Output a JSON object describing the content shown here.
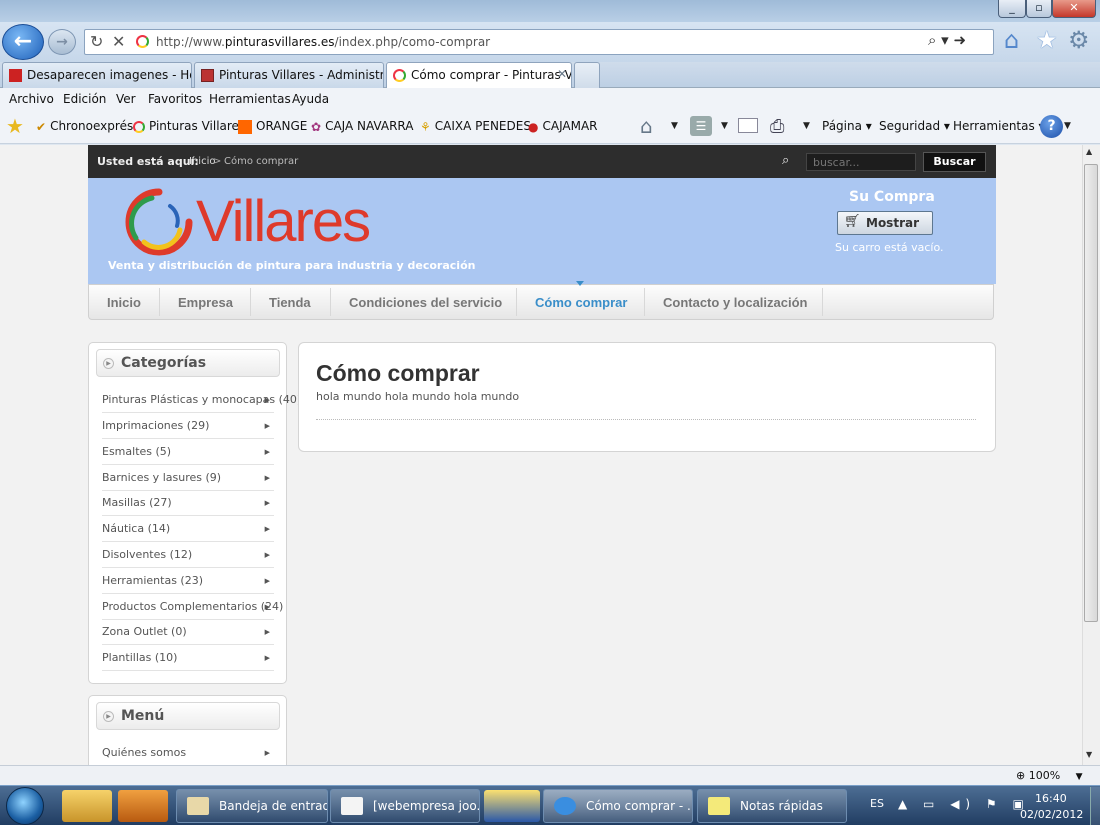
{
  "browser": {
    "url_prefix": "http://www.",
    "url_domain": "pinturasvillares.es",
    "url_path": "/index.php/como-comprar",
    "tabs": [
      {
        "label": "Desaparecen imagenes - Hosti..."
      },
      {
        "label": "Pinturas Villares - Administraci..."
      },
      {
        "label": "Cómo comprar - Pinturas V..."
      }
    ],
    "menu": [
      "Archivo",
      "Edición",
      "Ver",
      "Favoritos",
      "Herramientas",
      "Ayuda"
    ],
    "favorites": [
      "Chronoexprés",
      "Pinturas Villares",
      "ORANGE",
      "CAJA NAVARRA",
      "CAIXA PENEDES",
      "CAJAMAR"
    ],
    "commands": {
      "page": "Página ▾",
      "security": "Seguridad ▾",
      "tools": "Herramientas ▾"
    },
    "zoom": "100%"
  },
  "site": {
    "here_label": "Usted está aquí:",
    "breadcrumb_home": "Inicio",
    "breadcrumb_sep": ">",
    "breadcrumb_current": "Cómo comprar",
    "search_placeholder": "buscar...",
    "search_button": "Buscar",
    "logo_text": "Villares",
    "tagline": "Venta y distribución de pintura para industria y decoración",
    "cart": {
      "title": "Su Compra",
      "button": "Mostrar",
      "status": "Su carro está vacío."
    },
    "nav": [
      "Inicio",
      "Empresa",
      "Tienda",
      "Condiciones del servicio",
      "Cómo comprar",
      "Contacto y localización"
    ],
    "categories_title": "Categorías",
    "categories": [
      "Pinturas Plásticas y monocapas (40)",
      "Imprimaciones (29)",
      "Esmaltes (5)",
      "Barnices y lasures (9)",
      "Masillas (27)",
      "Náutica (14)",
      "Disolventes (12)",
      "Herramientas (23)",
      "Productos Complementarios (24)",
      "Zona Outlet (0)",
      "Plantillas (10)"
    ],
    "menu_title": "Menú",
    "menu_items": [
      "Quiénes somos"
    ],
    "content_title": "Cómo comprar",
    "content_body": "hola mundo hola mundo hola mundo"
  },
  "taskbar": {
    "tasks": [
      "Bandeja de entrad...",
      "[webempresa joo...",
      "Cómo comprar - ...",
      "Notas rápidas"
    ],
    "lang": "ES",
    "time": "16:40",
    "date": "02/02/2012"
  },
  "colors": {
    "brand_red": "#de3a2b",
    "header_blue": "#abc7f2",
    "nav_active": "#3a8ec9",
    "topbar": "#2d2d2d"
  }
}
